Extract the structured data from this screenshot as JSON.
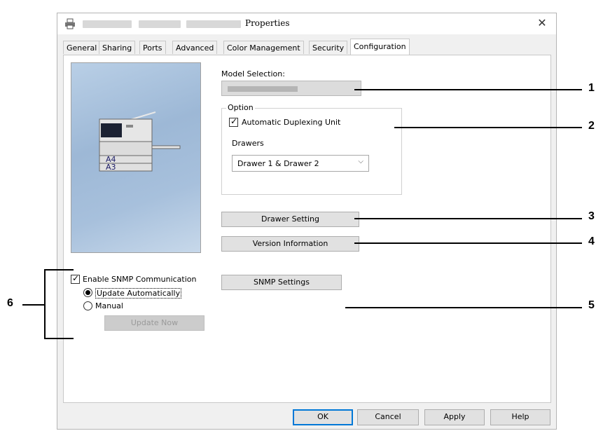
{
  "window": {
    "title": "Properties",
    "close_glyph": "✕"
  },
  "tabs": [
    "General",
    "Sharing",
    "Ports",
    "Advanced",
    "Color Management",
    "Security",
    "Configuration"
  ],
  "preview": {
    "paper_labels": [
      "A4",
      "A3"
    ]
  },
  "model": {
    "label": "Model Selection:"
  },
  "option_group": {
    "legend": "Option",
    "duplex_label": "Automatic Duplexing Unit",
    "duplex_checked": true,
    "drawers_label": "Drawers",
    "drawers_value": "Drawer 1 & Drawer 2"
  },
  "buttons": {
    "drawer_setting": "Drawer Setting",
    "version_info": "Version Information",
    "snmp_settings": "SNMP Settings",
    "update_now": "Update Now",
    "ok": "OK",
    "cancel": "Cancel",
    "apply": "Apply",
    "help": "Help"
  },
  "snmp": {
    "enable_label": "Enable SNMP Communication",
    "enable_checked": true,
    "update_auto_label": "Update Automatically",
    "manual_label": "Manual",
    "selected": "Update Automatically"
  },
  "callouts": [
    "1",
    "2",
    "3",
    "4",
    "5",
    "6"
  ]
}
